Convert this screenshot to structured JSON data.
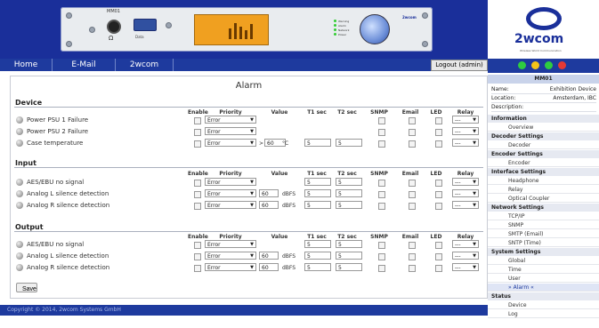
{
  "banner": {
    "device_tag": "MM01",
    "db9_label": "Data",
    "leds": [
      "Warning",
      "Alarm",
      "Network",
      "Power"
    ],
    "brand": "2wcom"
  },
  "nav": {
    "items": [
      "Home",
      "E-Mail",
      "2wcom"
    ],
    "logout_label": "Logout (admin)"
  },
  "page": {
    "title": "Alarm",
    "save_label": "Save",
    "footer": "Copyright © 2014, 2wcom Systems GmbH"
  },
  "columns": {
    "enable": "Enable",
    "priority": "Priority",
    "value": "Value",
    "t1": "T1 sec",
    "t2": "T2 sec",
    "snmp": "SNMP",
    "email": "Email",
    "led": "LED",
    "relay": "Relay"
  },
  "device": {
    "title": "Device",
    "rows": [
      {
        "label": "Power PSU 1 Failure",
        "priority": "Error",
        "relay": "---"
      },
      {
        "label": "Power PSU 2 Failure",
        "priority": "Error",
        "relay": "---"
      },
      {
        "label": "Case temperature",
        "priority": "Error",
        "relay": "---",
        "value_prefix": ">",
        "value": "60",
        "unit": "°C",
        "t1": "5",
        "t2": "5"
      }
    ]
  },
  "input": {
    "title": "Input",
    "rows": [
      {
        "label": "AES/EBU no signal",
        "priority": "Error",
        "relay": "---",
        "t1": "5",
        "t2": "5"
      },
      {
        "label": "Analog L silence detection",
        "priority": "Error",
        "relay": "---",
        "value": "60",
        "unit": "dBFS",
        "t1": "5",
        "t2": "5"
      },
      {
        "label": "Analog R silence detection",
        "priority": "Error",
        "relay": "---",
        "value": "60",
        "unit": "dBFS",
        "t1": "5",
        "t2": "5"
      }
    ]
  },
  "output": {
    "title": "Output",
    "rows": [
      {
        "label": "AES/EBU no signal",
        "priority": "Error",
        "relay": "---",
        "t1": "5",
        "t2": "5"
      },
      {
        "label": "Analog L silence detection",
        "priority": "Error",
        "relay": "---",
        "value": "60",
        "unit": "dBFS",
        "t1": "5",
        "t2": "5"
      },
      {
        "label": "Analog R silence detection",
        "priority": "Error",
        "relay": "---",
        "value": "60",
        "unit": "dBFS",
        "t1": "5",
        "t2": "5"
      }
    ]
  },
  "sidebar": {
    "logo_text": "2wcom",
    "logo_tag": "Wireless World Communication",
    "device_name": "MM01",
    "info": [
      {
        "k": "Name:",
        "v": "Exhibition Device"
      },
      {
        "k": "Location:",
        "v": "Amsterdam, IBC"
      },
      {
        "k": "Description:",
        "v": ""
      }
    ],
    "menu": [
      {
        "type": "h",
        "label": "Information"
      },
      {
        "type": "i",
        "label": "Overview"
      },
      {
        "type": "h",
        "label": "Decoder Settings"
      },
      {
        "type": "i",
        "label": "Decoder"
      },
      {
        "type": "h",
        "label": "Encoder Settings"
      },
      {
        "type": "i",
        "label": "Encoder"
      },
      {
        "type": "h",
        "label": "Interface Settings"
      },
      {
        "type": "i",
        "label": "Headphone"
      },
      {
        "type": "i",
        "label": "Relay"
      },
      {
        "type": "i",
        "label": "Optical Coupler"
      },
      {
        "type": "h",
        "label": "Network Settings"
      },
      {
        "type": "i",
        "label": "TCP/IP"
      },
      {
        "type": "i",
        "label": "SNMP"
      },
      {
        "type": "i",
        "label": "SMTP (Email)"
      },
      {
        "type": "i",
        "label": "SNTP (Time)"
      },
      {
        "type": "h",
        "label": "System Settings"
      },
      {
        "type": "i",
        "label": "Global"
      },
      {
        "type": "i",
        "label": "Time"
      },
      {
        "type": "i",
        "label": "User"
      },
      {
        "type": "i",
        "label": "» Alarm «",
        "active": true
      },
      {
        "type": "h",
        "label": "Status"
      },
      {
        "type": "i",
        "label": "Device"
      },
      {
        "type": "i",
        "label": "Log"
      }
    ],
    "status_icons": [
      "power-icon",
      "info-icon",
      "plus-icon",
      "alert-icon"
    ],
    "status_colors": [
      "#2ecc40",
      "#f5c518",
      "#2ecc40",
      "#e53935"
    ]
  }
}
